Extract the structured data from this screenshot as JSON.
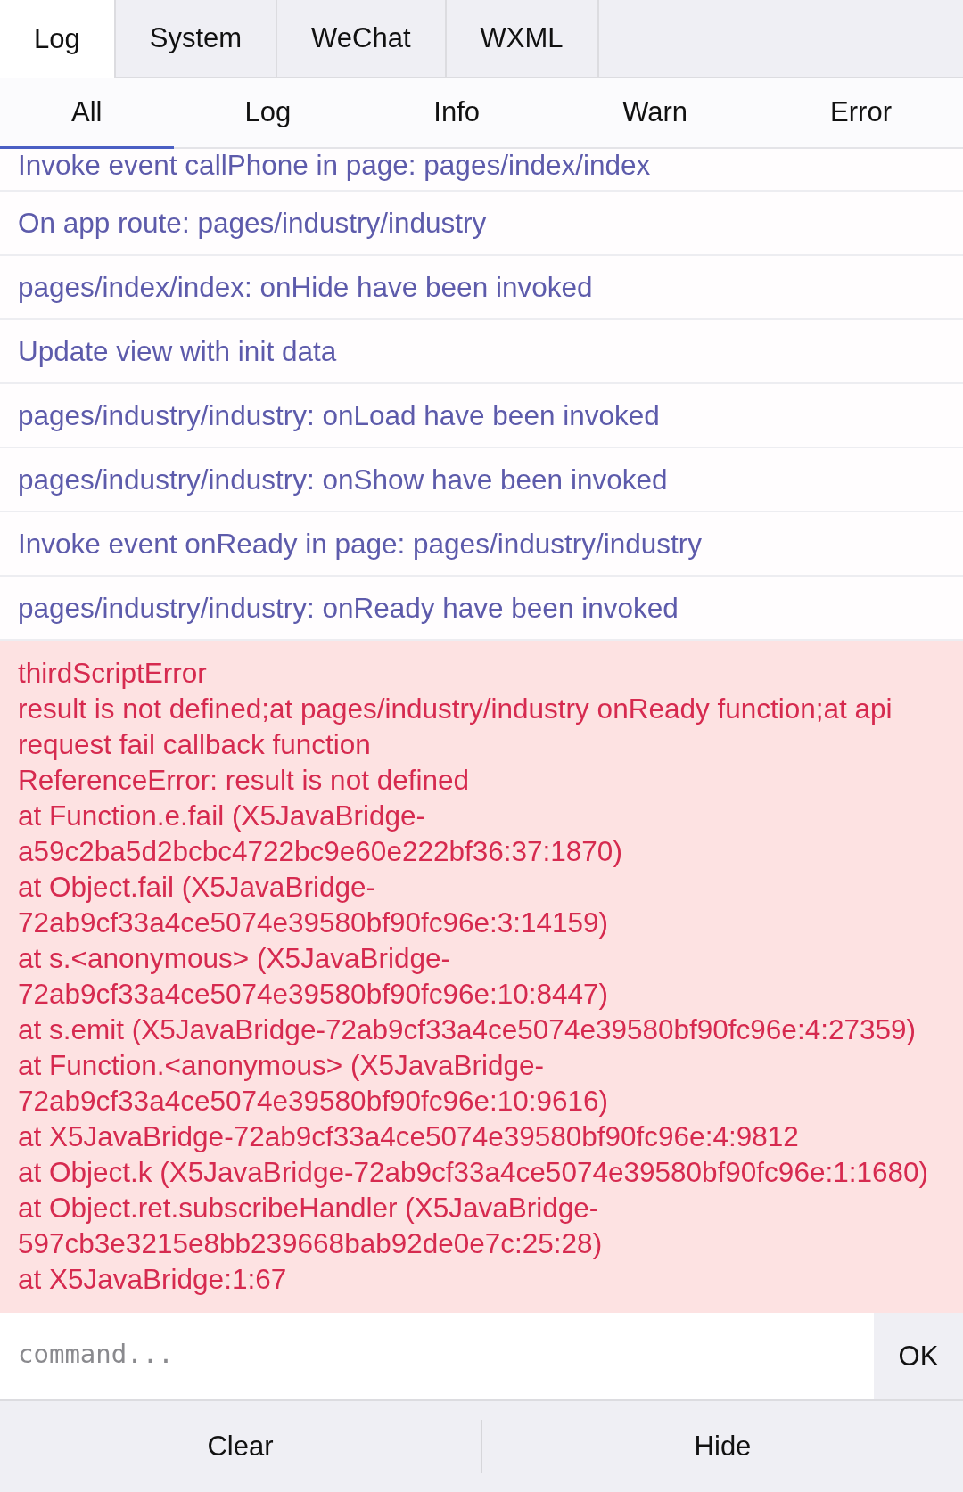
{
  "tabs": [
    {
      "label": "Log",
      "selected": true
    },
    {
      "label": "System",
      "selected": false
    },
    {
      "label": "WeChat",
      "selected": false
    },
    {
      "label": "WXML",
      "selected": false
    }
  ],
  "filters": [
    {
      "label": "All",
      "selected": true
    },
    {
      "label": "Log",
      "selected": false
    },
    {
      "label": "Info",
      "selected": false
    },
    {
      "label": "Warn",
      "selected": false
    },
    {
      "label": "Error",
      "selected": false
    }
  ],
  "logs": [
    {
      "kind": "log",
      "text": "Invoke event callPhone in page: pages/index/index"
    },
    {
      "kind": "log",
      "text": "On app route: pages/industry/industry"
    },
    {
      "kind": "log",
      "text": "pages/index/index: onHide have been invoked"
    },
    {
      "kind": "log",
      "text": "Update view with init data"
    },
    {
      "kind": "log",
      "text": "pages/industry/industry: onLoad have been invoked"
    },
    {
      "kind": "log",
      "text": "pages/industry/industry: onShow have been invoked"
    },
    {
      "kind": "log",
      "text": "Invoke event onReady in page: pages/industry/industry"
    },
    {
      "kind": "log",
      "text": "pages/industry/industry: onReady have been invoked"
    },
    {
      "kind": "error",
      "lines": [
        "thirdScriptError",
        "result is not defined;at pages/industry/industry onReady function;at api request fail callback function",
        "ReferenceError: result is not defined",
        "at Function.e.fail (X5JavaBridge-a59c2ba5d2bcbc4722bc9e60e222bf36:37:1870)",
        "at Object.fail (X5JavaBridge-72ab9cf33a4ce5074e39580bf90fc96e:3:14159)",
        "at s.<anonymous> (X5JavaBridge-72ab9cf33a4ce5074e39580bf90fc96e:10:8447)",
        "at s.emit (X5JavaBridge-72ab9cf33a4ce5074e39580bf90fc96e:4:27359)",
        "at Function.<anonymous> (X5JavaBridge-72ab9cf33a4ce5074e39580bf90fc96e:10:9616)",
        "at X5JavaBridge-72ab9cf33a4ce5074e39580bf90fc96e:4:9812",
        "at Object.k (X5JavaBridge-72ab9cf33a4ce5074e39580bf90fc96e:1:1680)",
        "at Object.ret.subscribeHandler (X5JavaBridge-597cb3e3215e8bb239668bab92de0e7c:25:28)",
        "at X5JavaBridge:1:67"
      ]
    }
  ],
  "command": {
    "placeholder": "command...",
    "button": "OK"
  },
  "footer": [
    {
      "label": "Clear"
    },
    {
      "label": "Hide"
    }
  ]
}
